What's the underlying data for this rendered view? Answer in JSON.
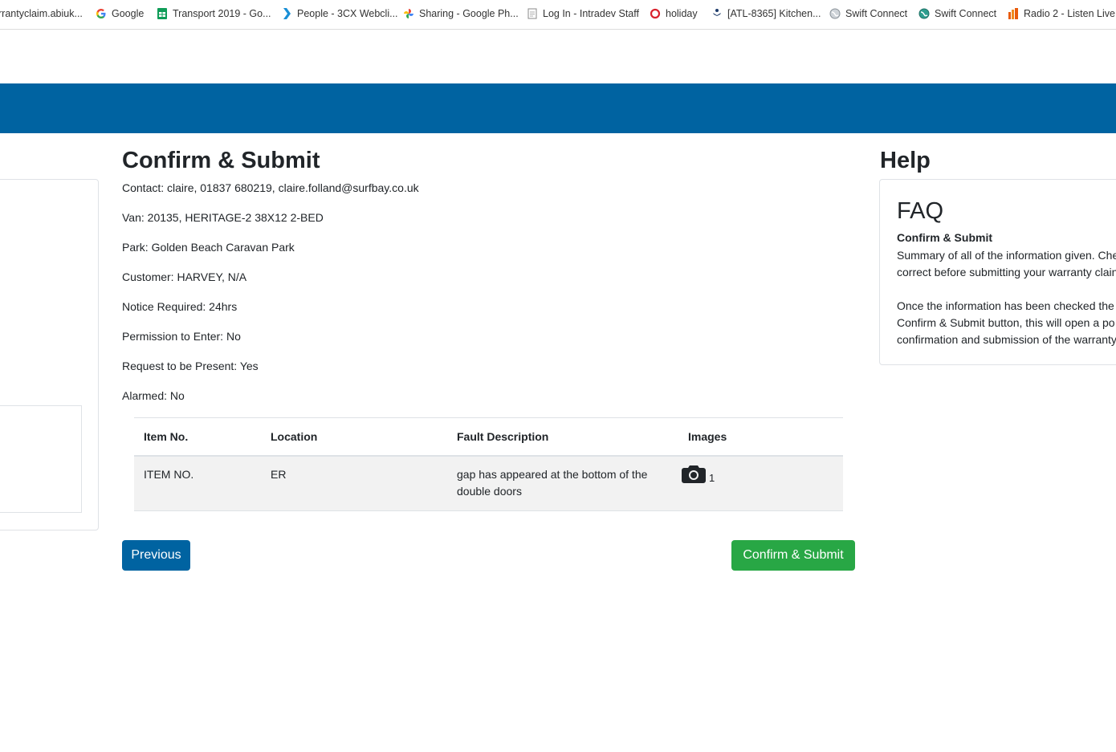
{
  "bookmarks": [
    {
      "label": "rrantyclaim.abiuk...",
      "icon": "page-icon"
    },
    {
      "label": "Google",
      "icon": "google-icon"
    },
    {
      "label": "Transport 2019 - Go...",
      "icon": "sheets-icon"
    },
    {
      "label": "People - 3CX Webcli...",
      "icon": "chevron-icon"
    },
    {
      "label": "Sharing - Google Ph...",
      "icon": "photos-icon"
    },
    {
      "label": "Log In - Intradev Staff",
      "icon": "document-icon"
    },
    {
      "label": "holiday",
      "icon": "circle-icon"
    },
    {
      "label": "[ATL-8365] Kitchen...",
      "icon": "jira-icon"
    },
    {
      "label": "Swift Connect",
      "icon": "globe-icon"
    },
    {
      "label": "Swift Connect",
      "icon": "globe-icon"
    },
    {
      "label": "Radio 2 - Listen Live...",
      "icon": "radio-icon"
    }
  ],
  "main": {
    "title": "Confirm & Submit",
    "fields": [
      {
        "label": "Contact:",
        "value": "claire, 01837 680219, claire.folland@surfbay.co.uk"
      },
      {
        "label": "Van:",
        "value": "20135, HERITAGE-2 38X12 2-BED"
      },
      {
        "label": "Park:",
        "value": "Golden Beach Caravan Park"
      },
      {
        "label": "Customer:",
        "value": "HARVEY, N/A"
      },
      {
        "label": "Notice Required:",
        "value": "24hrs"
      },
      {
        "label": "Permission to Enter:",
        "value": "No"
      },
      {
        "label": "Request to be Present:",
        "value": "Yes"
      },
      {
        "label": "Alarmed:",
        "value": "No"
      }
    ],
    "table": {
      "headers": [
        "Item No.",
        "Location",
        "Fault Description",
        "Images"
      ],
      "rows": [
        {
          "item": "ITEM NO.",
          "location": "ER",
          "fault": "gap has appeared at the bottom of the double doors",
          "images": "1"
        }
      ]
    },
    "previous_label": "Previous",
    "submit_label": "Confirm & Submit"
  },
  "help": {
    "title": "Help",
    "faq_title": "FAQ",
    "subtitle": "Confirm & Submit",
    "lines": [
      "Summary of all of the information given. Che",
      "correct before submitting your warranty clain",
      "",
      "Once the information has been checked the",
      "Confirm & Submit button, this will open a po",
      "confirmation and submission of the warranty"
    ]
  },
  "colors": {
    "primary": "#0063a1",
    "success": "#28a745",
    "row_bg": "#f2f2f2"
  }
}
